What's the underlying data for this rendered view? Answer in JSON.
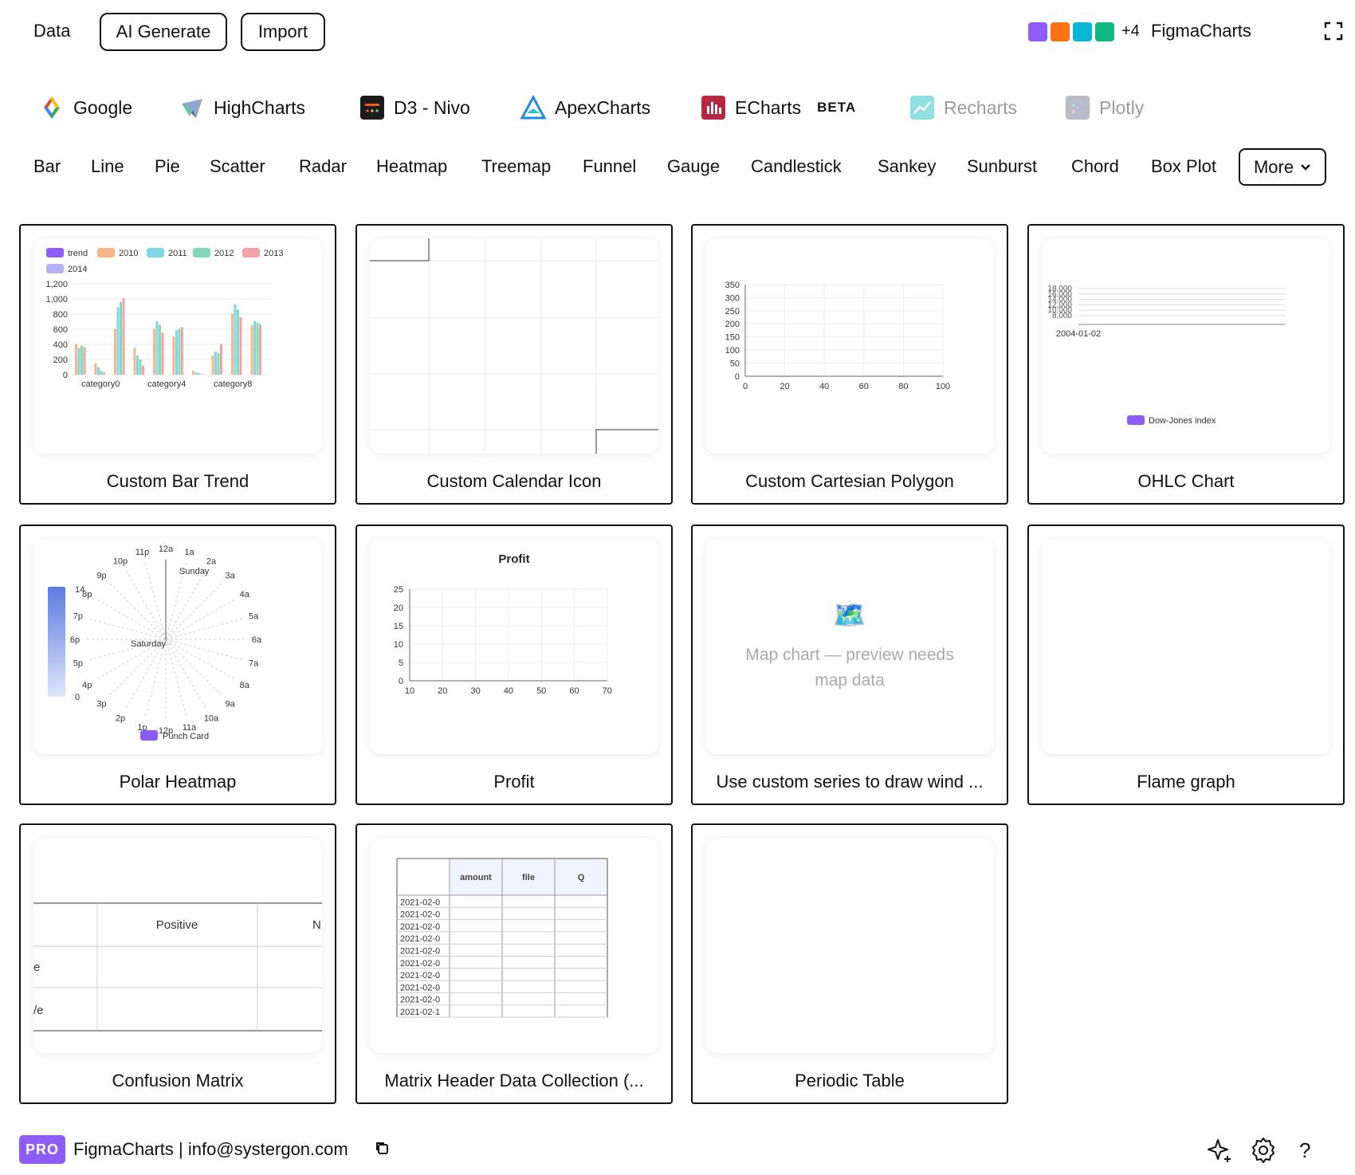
{
  "toolbar": {
    "data_label": "Data",
    "ai_label": "AI Generate",
    "import_label": "Import",
    "plus_count": "+4",
    "app_name": "FigmaCharts"
  },
  "swatch_colors": [
    "#8b5cf6",
    "#f97316",
    "#06b6d4",
    "#10b981"
  ],
  "libraries": [
    {
      "label": "Google",
      "icon": "google-icon"
    },
    {
      "label": "HighCharts",
      "icon": "highcharts-icon"
    },
    {
      "label": "D3 - Nivo",
      "icon": "nivo-icon"
    },
    {
      "label": "ApexCharts",
      "icon": "apexcharts-icon"
    },
    {
      "label": "ECharts",
      "icon": "echarts-icon",
      "badge": "BETA"
    },
    {
      "label": "Recharts",
      "icon": "recharts-icon"
    },
    {
      "label": "Plotly",
      "icon": "plotly-icon"
    }
  ],
  "chart_types": [
    "Bar",
    "Line",
    "Pie",
    "Scatter",
    "Radar",
    "Heatmap",
    "Treemap",
    "Funnel",
    "Gauge",
    "Candlestick",
    "Sankey",
    "Sunburst",
    "Chord",
    "Box Plot"
  ],
  "more_label": "More",
  "cards": [
    {
      "title": "Custom Bar Trend"
    },
    {
      "title": "Custom Calendar Icon"
    },
    {
      "title": "Custom Cartesian Polygon"
    },
    {
      "title": "OHLC Chart"
    },
    {
      "title": "Polar Heatmap"
    },
    {
      "title": "Profit"
    },
    {
      "title": "Use custom series to draw wind ..."
    },
    {
      "title": "Flame graph"
    },
    {
      "title": "Confusion Matrix"
    },
    {
      "title": "Matrix Header Data Collection (..."
    },
    {
      "title": "Periodic Table"
    }
  ],
  "map_preview": {
    "line1": "Map chart — preview needs",
    "line2": "map data"
  },
  "bar_trend": {
    "legend": [
      "trend",
      "2010",
      "2011",
      "2012",
      "2013",
      "2014"
    ],
    "colors": [
      "#8b5cf6",
      "#f8b58a",
      "#7fd6e8",
      "#7fdbb6",
      "#f4a0a8",
      "#b6b1f6"
    ],
    "yticks": [
      "1,200",
      "1,000",
      "800",
      "600",
      "400",
      "200",
      "0"
    ],
    "xticks": [
      "category0",
      "category4",
      "category8"
    ]
  },
  "cartesian": {
    "yticks": [
      "350",
      "300",
      "250",
      "200",
      "150",
      "100",
      "50",
      "0"
    ],
    "xticks": [
      "0",
      "20",
      "40",
      "60",
      "80",
      "100"
    ]
  },
  "ohlc": {
    "yticks": [
      "18,000",
      "16,000",
      "14,000",
      "12,000",
      "10,000",
      "8,000"
    ],
    "xtick": "2004-01-02",
    "legend": "Dow-Jones index"
  },
  "polar": {
    "hours": [
      "12a",
      "1a",
      "2a",
      "3a",
      "4a",
      "5a",
      "6a",
      "7a",
      "8a",
      "9a",
      "10a",
      "11a",
      "12p",
      "1p",
      "2p",
      "3p",
      "4p",
      "5p",
      "6p",
      "7p",
      "8p",
      "9p",
      "10p",
      "11p"
    ],
    "days": [
      "Sunday",
      "Saturday"
    ],
    "scale_max": "14",
    "scale_min": "0",
    "legend": "Punch Card"
  },
  "profit": {
    "title": "Profit",
    "yticks": [
      "25",
      "20",
      "15",
      "10",
      "5",
      "0"
    ],
    "xticks": [
      "10",
      "20",
      "30",
      "40",
      "50",
      "60",
      "70"
    ]
  },
  "confusion": {
    "header": "Positive",
    "header_cut": "N",
    "rows": [
      "e",
      "/e"
    ]
  },
  "matrix_table": {
    "headers": [
      "amount",
      "file",
      "Q"
    ],
    "rows": [
      "2021-02-0",
      "2021-02-0",
      "2021-02-0",
      "2021-02-0",
      "2021-02-0",
      "2021-02-0",
      "2021-02-0",
      "2021-02-0",
      "2021-02-0",
      "2021-02-1"
    ]
  },
  "footer": {
    "pro": "PRO",
    "text": "FigmaCharts | info@systergon.com",
    "help": "?"
  }
}
